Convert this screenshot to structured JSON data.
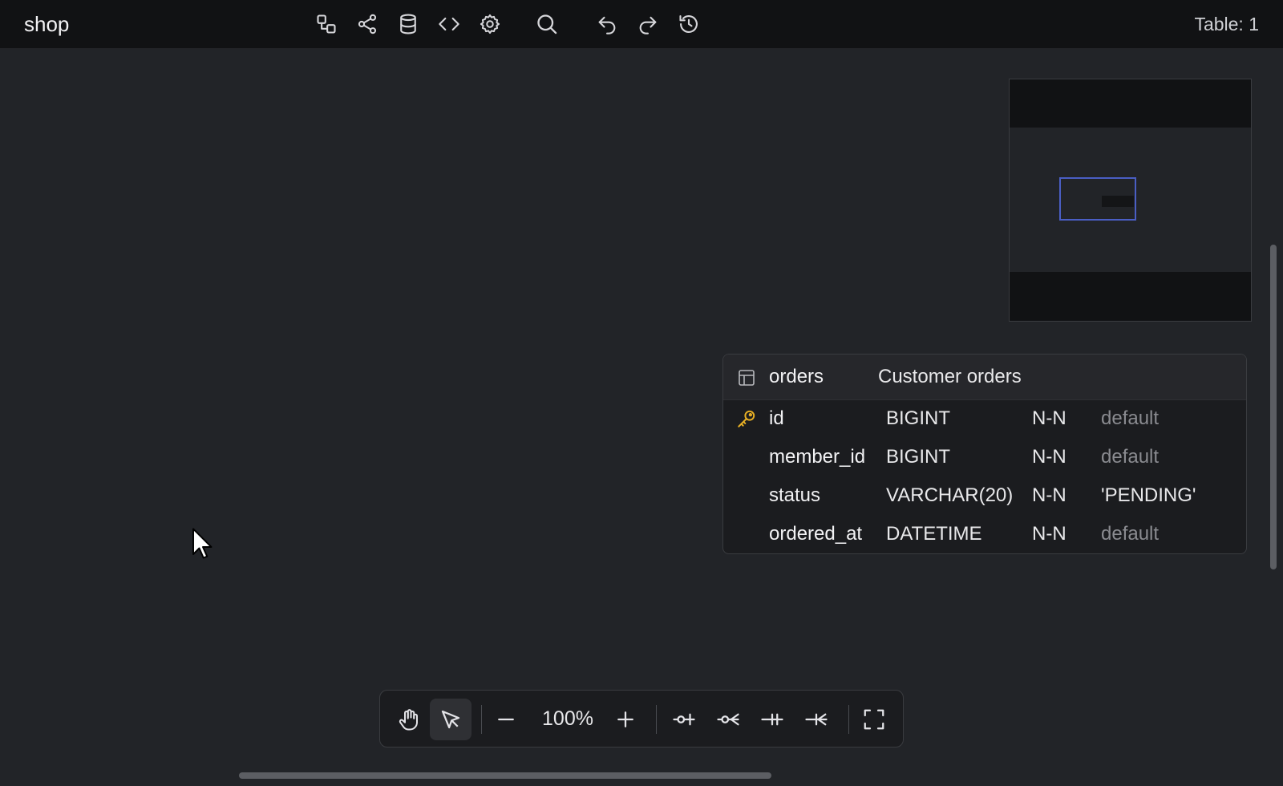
{
  "app": {
    "title": "shop"
  },
  "header": {
    "table_count": "Table: 1"
  },
  "icons": {
    "toolbar": [
      "relationship-icon",
      "share-icon",
      "database-icon",
      "code-icon",
      "settings-icon",
      "search-icon",
      "undo-icon",
      "redo-icon",
      "history-icon"
    ],
    "bottom": [
      "hand-icon",
      "pointer-icon",
      "zoom-out-icon",
      "zoom-in-icon",
      "one-to-one-icon",
      "one-to-many-icon",
      "one-to-one-identifying-icon",
      "many-to-one-icon",
      "fullscreen-icon"
    ]
  },
  "table": {
    "name": "orders",
    "comment": "Customer orders",
    "columns": [
      {
        "name": "id",
        "type": "BIGINT",
        "nullable": "N-N",
        "default": "default",
        "primary_key": true
      },
      {
        "name": "member_id",
        "type": "BIGINT",
        "nullable": "N-N",
        "default": "default",
        "primary_key": false
      },
      {
        "name": "status",
        "type": "VARCHAR(20)",
        "nullable": "N-N",
        "default": "'PENDING'",
        "primary_key": false
      },
      {
        "name": "ordered_at",
        "type": "DATETIME",
        "nullable": "N-N",
        "default": "default",
        "primary_key": false
      }
    ]
  },
  "toolbar": {
    "zoom": "100%"
  },
  "colors": {
    "background": "#222428",
    "topbar": "#111214",
    "key_icon": "#e8b025",
    "minimap_viewport": "#4a5ec4",
    "muted_text": "#8a8b90"
  }
}
